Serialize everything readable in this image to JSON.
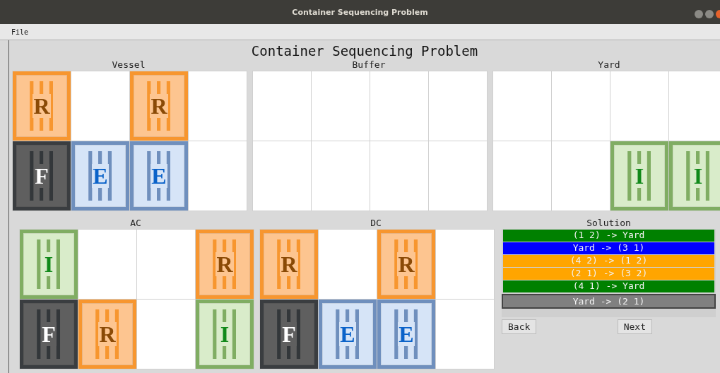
{
  "window": {
    "title": "Container Sequencing Problem"
  },
  "menu": [
    "File"
  ],
  "heading": "Container Sequencing Problem",
  "top_areas": [
    {
      "label": "Vessel",
      "rows": [
        [
          {
            "kind": "r",
            "letter": "R"
          },
          null,
          {
            "kind": "r",
            "letter": "R"
          },
          null
        ],
        [
          {
            "kind": "f",
            "letter": "F"
          },
          {
            "kind": "e",
            "letter": "E"
          },
          {
            "kind": "e",
            "letter": "E"
          },
          null
        ]
      ]
    },
    {
      "label": "Buffer",
      "rows": [
        [
          null,
          null,
          null,
          null
        ],
        [
          null,
          null,
          null,
          null
        ]
      ]
    },
    {
      "label": "Yard",
      "rows": [
        [
          null,
          null,
          null,
          null
        ],
        [
          null,
          null,
          {
            "kind": "i",
            "letter": "I"
          },
          {
            "kind": "i",
            "letter": "I"
          }
        ]
      ]
    }
  ],
  "bottom_areas": [
    {
      "label": "AC",
      "rows": [
        [
          {
            "kind": "i",
            "letter": "I"
          },
          null,
          null,
          {
            "kind": "r",
            "letter": "R"
          }
        ],
        [
          {
            "kind": "f",
            "letter": "F"
          },
          {
            "kind": "r",
            "letter": "R"
          },
          null,
          {
            "kind": "i",
            "letter": "I"
          }
        ]
      ]
    },
    {
      "label": "DC",
      "rows": [
        [
          {
            "kind": "r",
            "letter": "R"
          },
          null,
          {
            "kind": "r",
            "letter": "R"
          },
          null
        ],
        [
          {
            "kind": "f",
            "letter": "F"
          },
          {
            "kind": "e",
            "letter": "E"
          },
          {
            "kind": "e",
            "letter": "E"
          },
          null
        ]
      ]
    }
  ],
  "solution": {
    "label": "Solution",
    "steps": [
      {
        "text": "(1 2) -> Yard",
        "color": "#008000",
        "selected": false
      },
      {
        "text": "Yard -> (3 1)",
        "color": "#0000ff",
        "selected": false
      },
      {
        "text": "(4 2) -> (1 2)",
        "color": "#ffa500",
        "selected": false
      },
      {
        "text": "(2 1) -> (3 2)",
        "color": "#ffa500",
        "selected": false
      },
      {
        "text": "(4 1) -> Yard",
        "color": "#008000",
        "selected": false
      },
      {
        "text": "Yard -> (2 1)",
        "color": "#808080",
        "selected": true
      }
    ],
    "buttons": [
      "Back",
      "Next"
    ]
  }
}
